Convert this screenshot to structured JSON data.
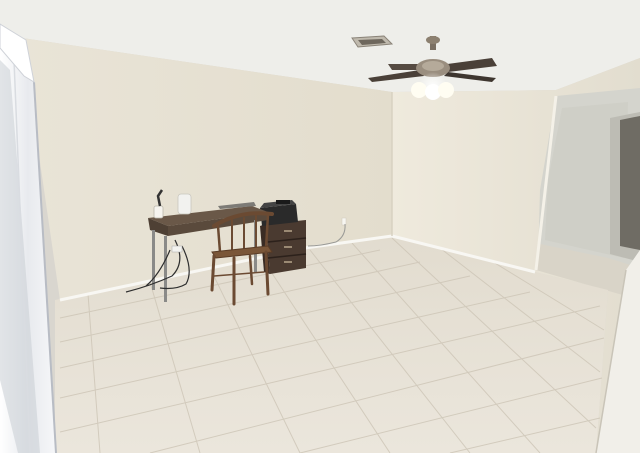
{
  "scene": {
    "kind": "photograph",
    "colors": {
      "ceiling": "#eeeeea",
      "wall_left": "#e6e2d6",
      "wall_back": "#ece7d9",
      "wall_right": "#e8e3d4",
      "floor": "#e4ddd0",
      "tile_line": "#cdc5b6",
      "baseboard": "#f7f6f2",
      "hallway_wall": "#d2d2cc",
      "desk_top": "#5a4a3c",
      "desk_leg": "#8a8a88",
      "chair_wood": "#6b4a32",
      "cabinet": "#4a3a30",
      "printer": "#2a2a2a",
      "fan_blade": "#4a4038",
      "fan_light": "#fffdf2",
      "curtain": "#f3f4f6"
    },
    "objects": [
      "sliding-door-curtain",
      "ceiling-fan",
      "ceiling-vent",
      "writing-desk",
      "wooden-chair",
      "filing-cabinet",
      "printer",
      "hallway-doorway",
      "tile-floor"
    ]
  }
}
